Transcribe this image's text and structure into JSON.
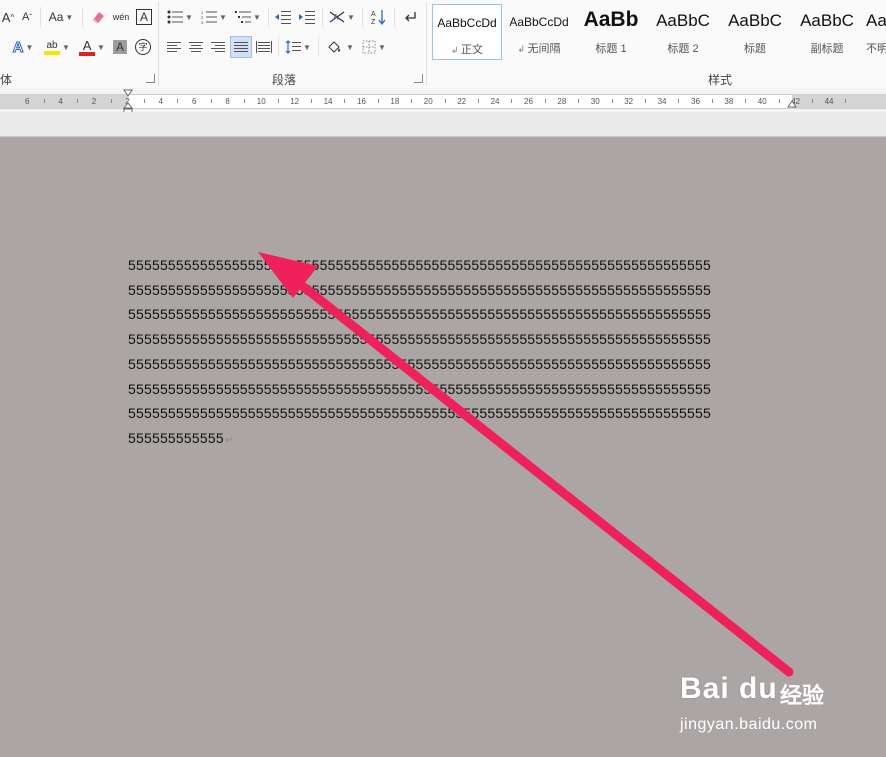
{
  "ribbon": {
    "font_group_label_fragment": "体",
    "paragraph_group_label": "段落",
    "styles_group_label": "样式",
    "font_case_label": "Aa",
    "grow_font_label": "A",
    "shrink_font_label": "A",
    "phonetic_label": "wén",
    "char_border_label": "A",
    "text_effects_label": "A",
    "highlight_label": "ab",
    "font_color_label": "A",
    "char_shading_label": "A",
    "enclose_label": "字",
    "sort_label": "A↓Z"
  },
  "styles": [
    {
      "preview": "AaBbCcDd",
      "name": "正文",
      "active": true
    },
    {
      "preview": "AaBbCcDd",
      "name": "无间隔",
      "active": false
    },
    {
      "preview": "AaBb",
      "name": "标题 1",
      "active": false
    },
    {
      "preview": "AaBbC",
      "name": "标题 2",
      "active": false
    },
    {
      "preview": "AaBbC",
      "name": "标题",
      "active": false
    },
    {
      "preview": "AaBbC",
      "name": "副标题",
      "active": false
    },
    {
      "preview": "AaBbC",
      "name": "不明",
      "active": false
    }
  ],
  "ruler": {
    "labels": [
      "6",
      "4",
      "2",
      "2",
      "4",
      "6",
      "8",
      "10",
      "12",
      "14",
      "16",
      "18",
      "20",
      "22",
      "24",
      "26",
      "28",
      "30",
      "32",
      "34",
      "36",
      "38",
      "40",
      "42",
      "44"
    ]
  },
  "document": {
    "lines": [
      "5555555555555555555555555555555555555555555555555555555555555555555555555",
      "5555555555555555555555555555555555555555555555555555555555555555555555555",
      "5555555555555555555555555555555555555555555555555555555555555555555555555",
      "5555555555555555555555555555555555555555555555555555555555555555555555555",
      "5555555555555555555555555555555555555555555555555555555555555555555555555",
      "5555555555555555555555555555555555555555555555555555555555555555555555555",
      "5555555555555555555555555555555555555555555555555555555555555555555555555",
      "555555555555"
    ],
    "paragraph_mark": "↵"
  },
  "watermark": {
    "logo": "Bai du",
    "brand_cn": "经验",
    "url": "jingyan.baidu.com"
  },
  "colors": {
    "canvas": "#aba6a5",
    "arrow": "#f0205a",
    "font_color_bar": "#e02020",
    "highlight_bar": "#f5e500",
    "accent": "#2b579a"
  }
}
